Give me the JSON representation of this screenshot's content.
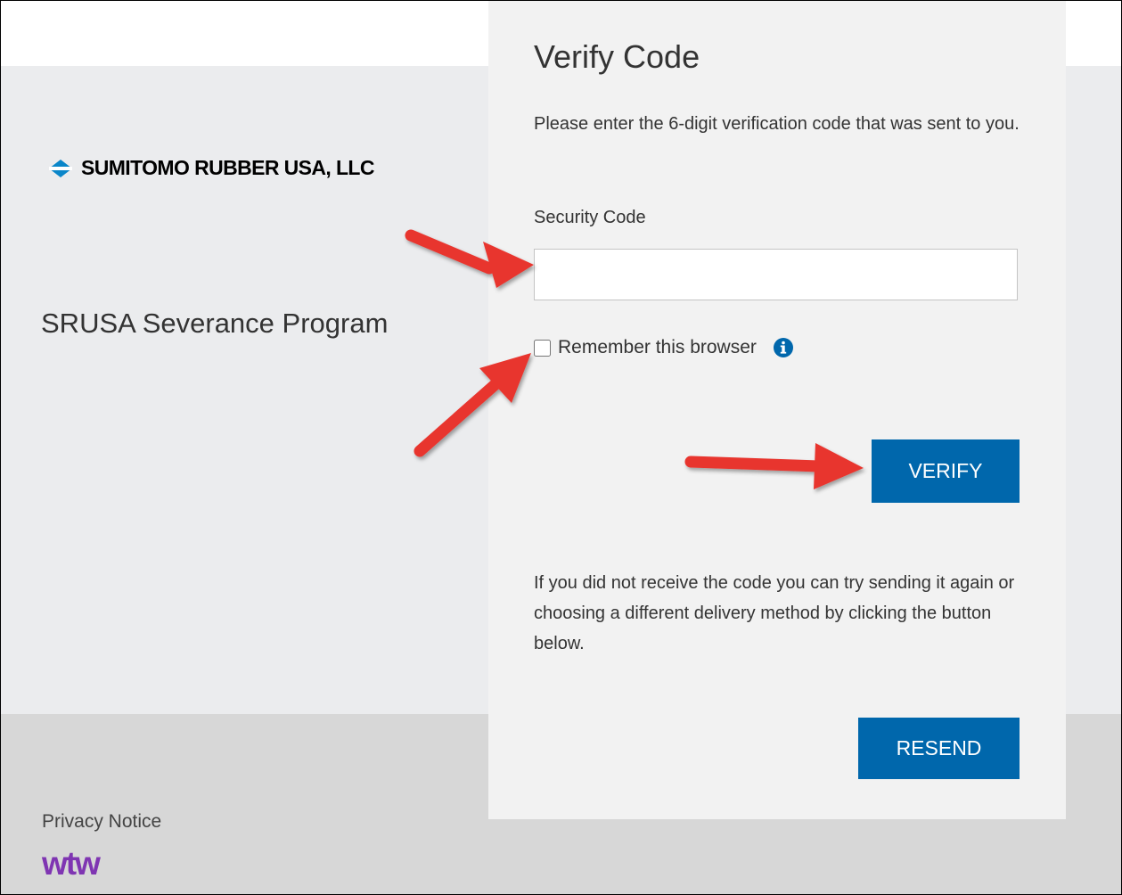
{
  "brand": {
    "company_name": "SUMITOMO RUBBER USA, LLC",
    "accent_color": "#0a86c9",
    "button_color": "#0067ac",
    "annotation_color": "#e8352f"
  },
  "program": {
    "title": "SRUSA Severance Program"
  },
  "footer": {
    "privacy_label": "Privacy Notice",
    "partner_logo": "wtw"
  },
  "verify": {
    "heading": "Verify Code",
    "instructions": "Please enter the 6-digit verification code that was sent to you.",
    "code_label": "Security Code",
    "code_value": "",
    "remember_label": "Remember this browser",
    "remember_checked": false,
    "info_icon": "info-circle-icon",
    "verify_button": "VERIFY",
    "resend_info": "If you did not receive the code you can try sending it again or choosing a different delivery method by clicking the button below.",
    "resend_button": "RESEND"
  },
  "annotations": {
    "arrow_icon": "red-arrow-icon"
  }
}
